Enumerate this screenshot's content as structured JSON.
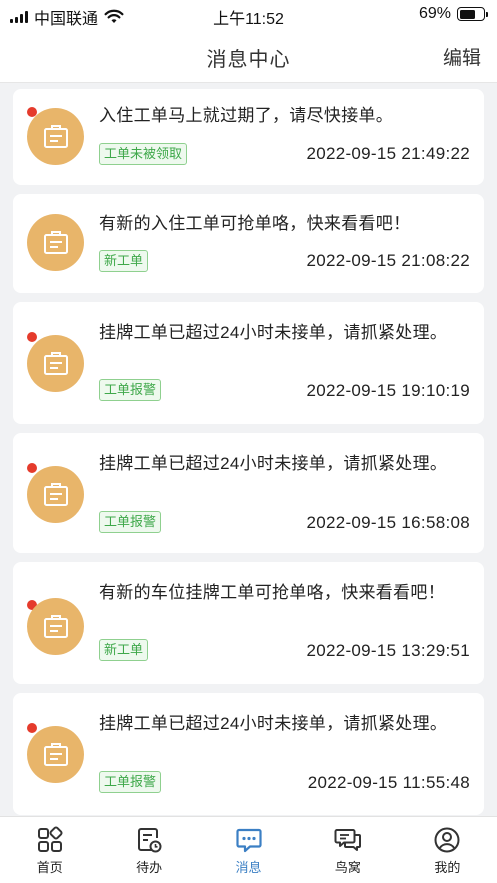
{
  "status_bar": {
    "carrier": "中国联通",
    "time": "上午11:52",
    "battery": "69%",
    "battery_level": 0.69
  },
  "header": {
    "title": "消息中心",
    "edit_label": "编辑"
  },
  "messages": [
    {
      "text": "入住工单马上就过期了，请尽快接单。",
      "tag": "工单未被领取",
      "time": "2022-09-15 21:49:22",
      "unread": true
    },
    {
      "text": "有新的入住工单可抢单咯，快来看看吧！",
      "tag": "新工单",
      "time": "2022-09-15 21:08:22",
      "unread": false
    },
    {
      "text": "挂牌工单已超过24小时未接单，请抓紧处理。",
      "tag": "工单报警",
      "time": "2022-09-15 19:10:19",
      "unread": true
    },
    {
      "text": "挂牌工单已超过24小时未接单，请抓紧处理。",
      "tag": "工单报警",
      "time": "2022-09-15 16:58:08",
      "unread": true
    },
    {
      "text": "有新的车位挂牌工单可抢单咯，快来看看吧！",
      "tag": "新工单",
      "time": "2022-09-15 13:29:51",
      "unread": true
    },
    {
      "text": "挂牌工单已超过24小时未接单，请抓紧处理。",
      "tag": "工单报警",
      "time": "2022-09-15 11:55:48",
      "unread": true
    }
  ],
  "tabs": [
    {
      "label": "首页",
      "icon": "home-grid-icon",
      "active": false
    },
    {
      "label": "待办",
      "icon": "todo-clock-icon",
      "active": false
    },
    {
      "label": "消息",
      "icon": "message-icon",
      "active": true
    },
    {
      "label": "鸟窝",
      "icon": "chat-bubbles-icon",
      "active": false
    },
    {
      "label": "我的",
      "icon": "user-icon",
      "active": false
    }
  ],
  "colors": {
    "accent": "#3b7fc4",
    "avatar_bg": "#e8b56a",
    "unread_dot": "#e53b2c",
    "tag_green": "#3fa84a"
  }
}
